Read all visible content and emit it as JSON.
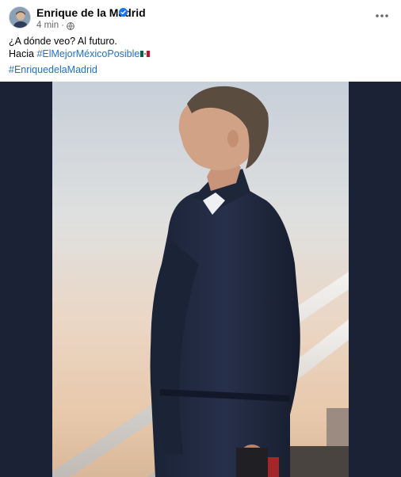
{
  "post": {
    "author_name": "Enrique de la Madrid",
    "timestamp": "4 min",
    "separator": "·",
    "audience_icon": "globe-icon",
    "verified_icon": "verified-badge-icon",
    "more_icon": "more-options-icon",
    "text_line_1": "¿A dónde veo? Al futuro.",
    "text_line_2_prefix": "Hacia ",
    "hashtag_1": "#ElMejorMéxicoPosible",
    "flag_emoji": "mexico-flag-icon",
    "hashtag_2": "#EnriquedelaMadrid"
  },
  "colors": {
    "link": "#216fdb",
    "verified": "#1877f2",
    "secondary_text": "#65676b",
    "photo_background": "#1c2235"
  }
}
